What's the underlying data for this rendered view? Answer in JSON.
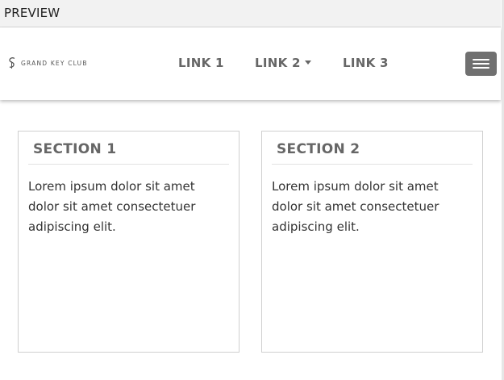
{
  "preview": {
    "label": "PREVIEW"
  },
  "navbar": {
    "brand": {
      "text": "GRAND KEY CLUB",
      "icon": "brand-logo-icon"
    },
    "links": [
      {
        "label": "LINK 1"
      },
      {
        "label": "LINK 2",
        "has_dropdown": true,
        "icon": "caret-down-icon"
      },
      {
        "label": "LINK 3"
      }
    ],
    "menu_button": {
      "icon": "hamburger-menu-icon"
    }
  },
  "sections": [
    {
      "title": "SECTION 1",
      "body": "Lorem ipsum dolor sit amet dolor sit amet consectetuer adipiscing elit."
    },
    {
      "title": "SECTION 2",
      "body": "Lorem ipsum dolor sit amet dolor sit amet consectetuer adipiscing elit."
    }
  ],
  "colors": {
    "preview_bar": "#f2f2f2",
    "nav_text": "#666666",
    "menu_button": "#707070",
    "card_border": "#cfcfcf",
    "body_text": "#333333"
  }
}
